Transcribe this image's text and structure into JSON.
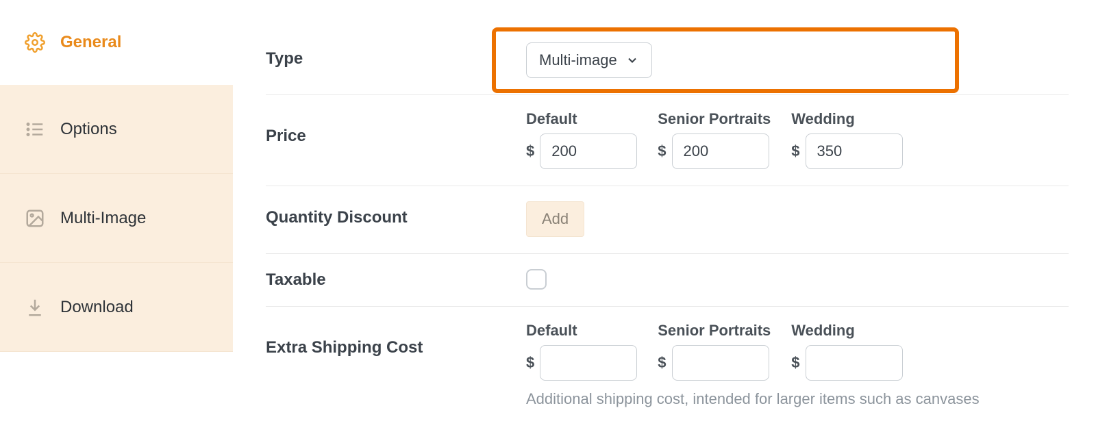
{
  "sidebar": {
    "items": [
      {
        "label": "General",
        "icon": "gear-icon",
        "active": true
      },
      {
        "label": "Options",
        "icon": "list-icon",
        "active": false
      },
      {
        "label": "Multi-Image",
        "icon": "image-icon",
        "active": false
      },
      {
        "label": "Download",
        "icon": "download-icon",
        "active": false
      }
    ]
  },
  "form": {
    "type": {
      "label": "Type",
      "selected": "Multi-image"
    },
    "price": {
      "label": "Price",
      "currency": "$",
      "columns": [
        {
          "header": "Default",
          "value": "200"
        },
        {
          "header": "Senior Portraits",
          "value": "200"
        },
        {
          "header": "Wedding",
          "value": "350"
        }
      ]
    },
    "quantity_discount": {
      "label": "Quantity Discount",
      "add_button": "Add"
    },
    "taxable": {
      "label": "Taxable",
      "checked": false
    },
    "extra_shipping": {
      "label": "Extra Shipping Cost",
      "currency": "$",
      "columns": [
        {
          "header": "Default",
          "value": ""
        },
        {
          "header": "Senior Portraits",
          "value": ""
        },
        {
          "header": "Wedding",
          "value": ""
        }
      ],
      "help": "Additional shipping cost, intended for larger items such as canvases"
    }
  }
}
